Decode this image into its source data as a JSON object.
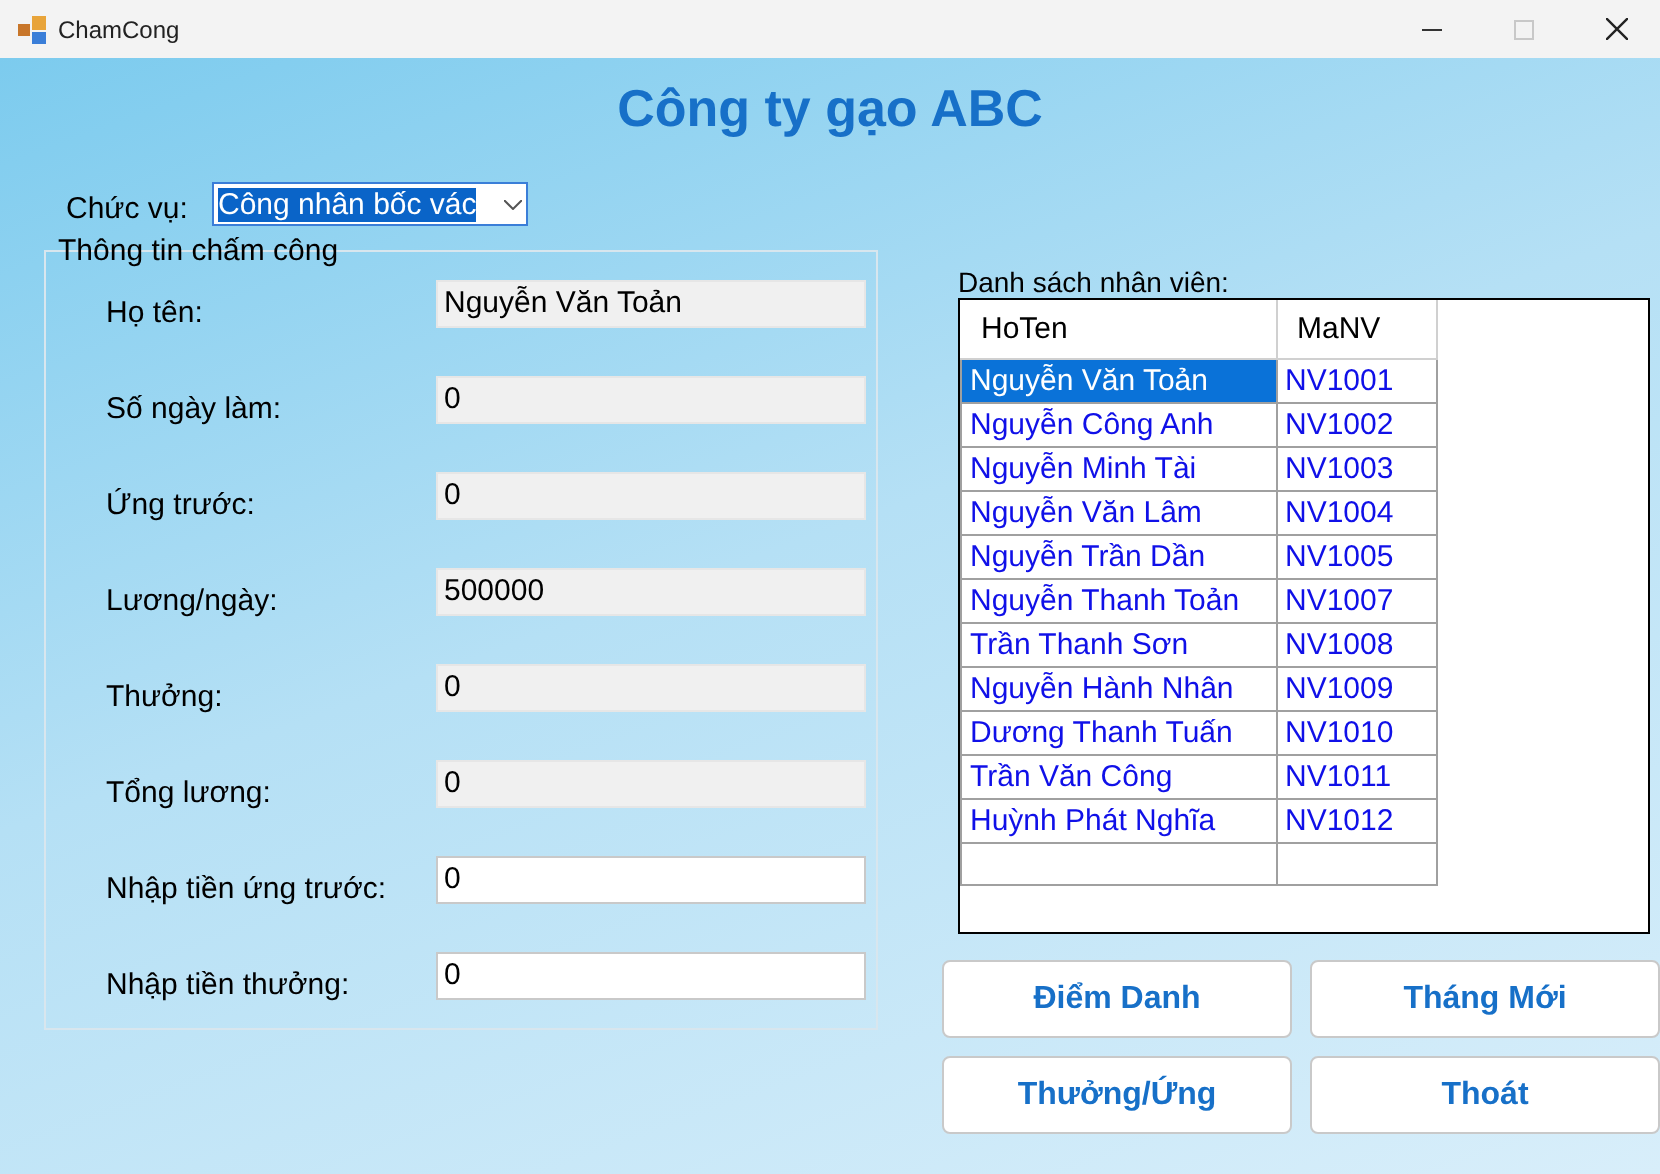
{
  "window": {
    "title": "ChamCong",
    "controls": [
      {
        "kind": "minimize",
        "disabled": false
      },
      {
        "kind": "maximize",
        "disabled": true
      },
      {
        "kind": "close",
        "disabled": false
      }
    ]
  },
  "heading": "Công ty gạo ABC",
  "position": {
    "label": "Chức vụ:",
    "value": "Công nhân bốc vác"
  },
  "group": {
    "title": "Thông tin chấm công",
    "fields": [
      {
        "label": "Họ tên:",
        "value": "Nguyễn Văn Toản",
        "readonly": true
      },
      {
        "label": "Số ngày làm:",
        "value": "0",
        "readonly": true
      },
      {
        "label": "Ứng trước:",
        "value": "0",
        "readonly": true
      },
      {
        "label": "Lương/ngày:",
        "value": "500000",
        "readonly": true
      },
      {
        "label": "Thưởng:",
        "value": "0",
        "readonly": true
      },
      {
        "label": "Tổng lương:",
        "value": "0",
        "readonly": true
      },
      {
        "label": "Nhập tiền ứng trước:",
        "value": "0",
        "readonly": false
      },
      {
        "label": "Nhập tiền thưởng:",
        "value": "0",
        "readonly": false
      }
    ]
  },
  "employees": {
    "label": "Danh sách nhân viên:",
    "columns": [
      "HoTen",
      "MaNV"
    ],
    "rows": [
      {
        "cells": [
          "Nguyễn Văn Toản",
          "NV1001"
        ],
        "selected": true
      },
      {
        "cells": [
          "Nguyễn Công Anh",
          "NV1002"
        ],
        "selected": false
      },
      {
        "cells": [
          "Nguyễn Minh Tài",
          "NV1003"
        ],
        "selected": false
      },
      {
        "cells": [
          "Nguyễn Văn Lâm",
          "NV1004"
        ],
        "selected": false
      },
      {
        "cells": [
          "Nguyễn Trần Dần",
          "NV1005"
        ],
        "selected": false
      },
      {
        "cells": [
          "Nguyễn Thanh Toản",
          "NV1007"
        ],
        "selected": false
      },
      {
        "cells": [
          "Trần Thanh Sơn",
          "NV1008"
        ],
        "selected": false
      },
      {
        "cells": [
          "Nguyễn Hành Nhân",
          "NV1009"
        ],
        "selected": false
      },
      {
        "cells": [
          "Dương Thanh Tuấn",
          "NV1010"
        ],
        "selected": false
      },
      {
        "cells": [
          "Trần Văn Công",
          "NV1011"
        ],
        "selected": false
      },
      {
        "cells": [
          "Huỳnh Phát Nghĩa",
          "NV1012"
        ],
        "selected": false
      }
    ]
  },
  "buttons": [
    "Điểm Danh",
    "Tháng Mới",
    "Thưởng/Ứng",
    "Thoát"
  ]
}
